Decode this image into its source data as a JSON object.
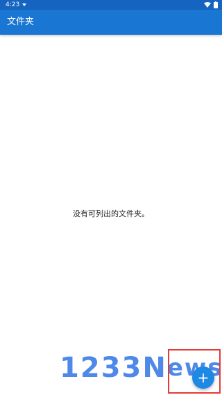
{
  "status_bar": {
    "time": "4:23",
    "notification_icon": "download-arrow-icon",
    "wifi_icon": "wifi-icon",
    "battery_icon": "battery-icon"
  },
  "app_bar": {
    "title": "文件夹",
    "color": "#1976d2"
  },
  "main": {
    "empty_message": "没有可列出的文件夹。"
  },
  "watermark": {
    "chars": [
      "1",
      "2",
      "3",
      "3",
      "N",
      "e",
      "w",
      "s"
    ]
  },
  "fab": {
    "icon": "plus-icon",
    "symbol": "+",
    "color": "#1e88e5"
  },
  "highlight": {
    "color": "#e53935"
  }
}
